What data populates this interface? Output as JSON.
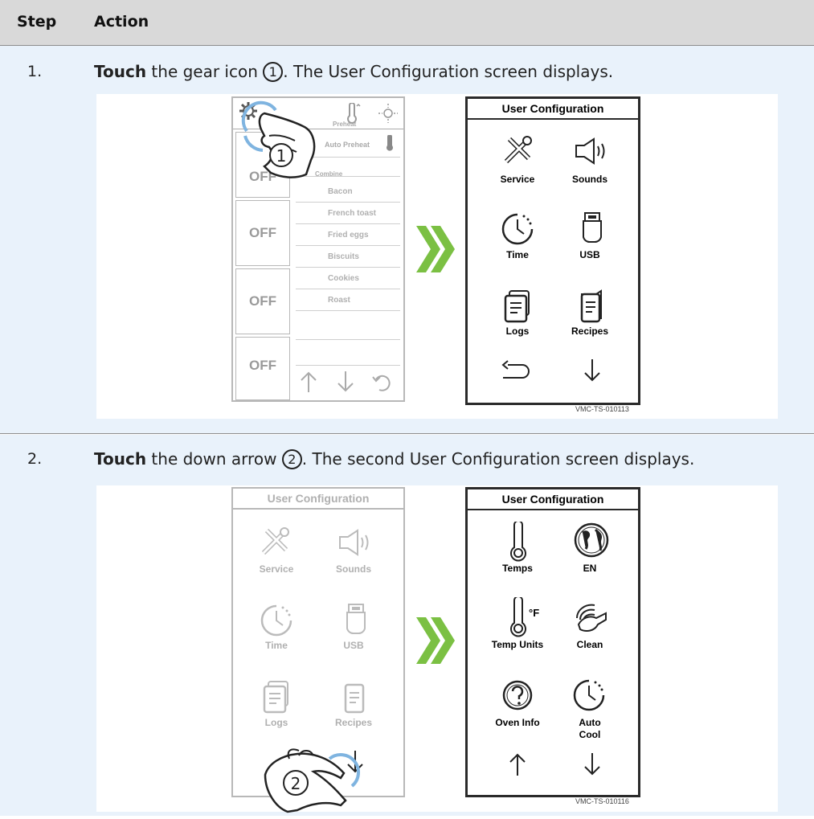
{
  "table": {
    "col_step": "Step",
    "col_action": "Action"
  },
  "steps": [
    {
      "number": "1.",
      "action_bold": "Touch",
      "action_pre": " the gear icon ",
      "marker": "1",
      "action_post": ". The User Configuration screen displays.",
      "left_screen": {
        "preheat": "Preheat",
        "auto_preheat": "Auto Preheat",
        "combine": "Combine",
        "off": "OFF",
        "recipes": [
          "Bacon",
          "French toast",
          "Fried eggs",
          "Biscuits",
          "Cookies",
          "Roast"
        ],
        "callout": "1"
      },
      "right_screen": {
        "title": "User Configuration",
        "items": [
          "Service",
          "Sounds",
          "Time",
          "USB",
          "Logs",
          "Recipes"
        ]
      },
      "figure_code": "VMC-TS-010113"
    },
    {
      "number": "2.",
      "action_bold": "Touch",
      "action_pre": " the down arrow ",
      "marker": "2",
      "action_post": ". The second User Configuration screen displays.",
      "left_screen": {
        "title": "User Configuration",
        "items": [
          "Service",
          "Sounds",
          "Time",
          "USB",
          "Logs",
          "Recipes"
        ],
        "callout": "2"
      },
      "right_screen": {
        "title": "User Configuration",
        "items": [
          "Temps",
          "EN",
          "Temp Units",
          "Clean",
          "Oven Info",
          "Auto Cool"
        ],
        "temp_unit": "°F"
      },
      "figure_code": "VMC-TS-010116"
    }
  ],
  "colors": {
    "header_bg": "#d9d9d9",
    "row_bg": "#e9f2fb",
    "arrow_green": "#7bc043",
    "touch_ring": "#7fb4e0"
  }
}
